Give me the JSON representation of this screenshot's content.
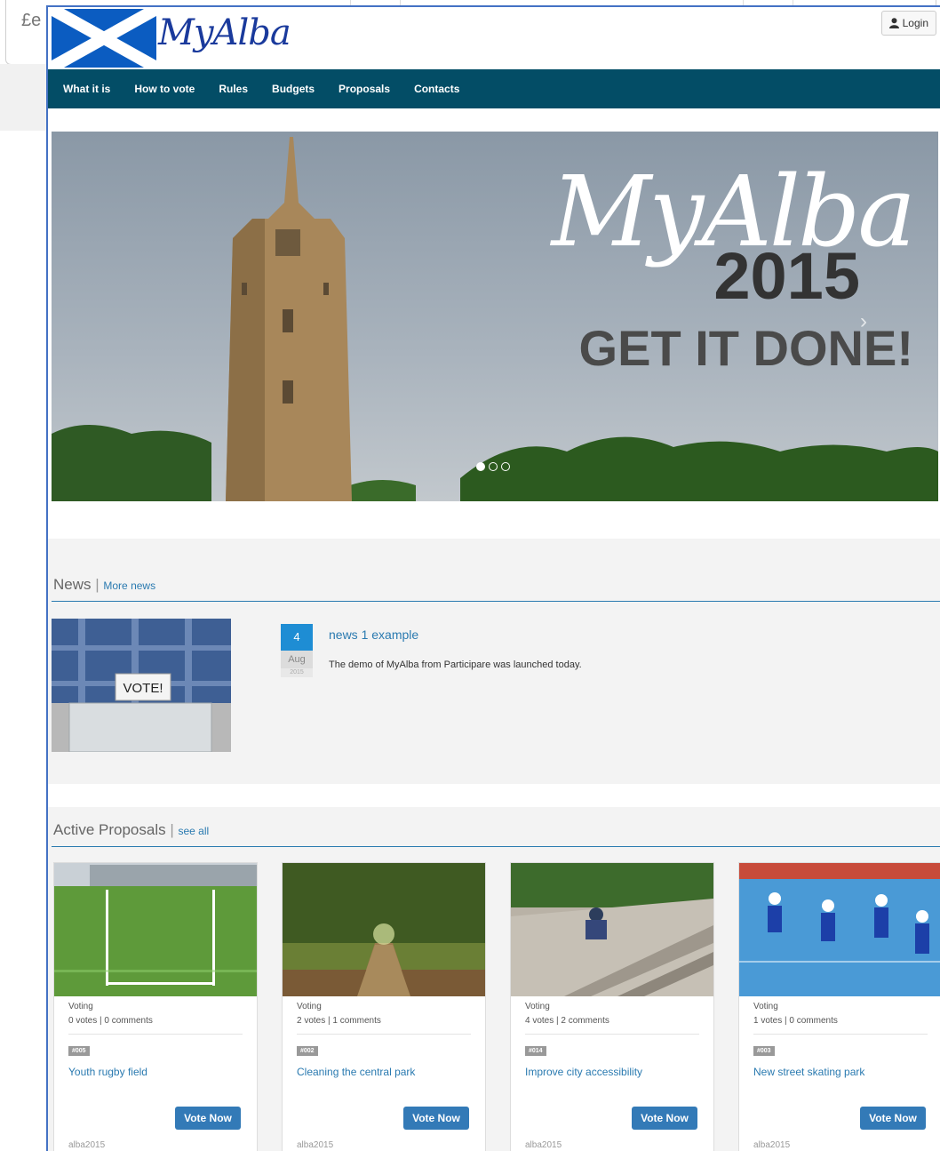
{
  "background": {
    "partial_text": "£e"
  },
  "header": {
    "logo_text": "MyAlba",
    "login_label": "Login"
  },
  "nav": {
    "items": [
      "What it is",
      "How to vote",
      "Rules",
      "Budgets",
      "Proposals",
      "Contacts"
    ]
  },
  "hero": {
    "title": "MyAlba",
    "year": "2015",
    "slogan": "GET IT DONE!",
    "slide_count": 3,
    "active_slide": 1
  },
  "news": {
    "heading": "News",
    "more_link": "More news",
    "items": [
      {
        "day": "4",
        "month": "Aug",
        "year": "2015",
        "title": "news 1 example",
        "body": "The demo of MyAlba from Participare was launched today.",
        "image_caption": "VOTE!"
      }
    ]
  },
  "proposals": {
    "heading": "Active Proposals",
    "see_all": "see all",
    "items": [
      {
        "status": "Voting",
        "stats": "0 votes | 0 comments",
        "tag": "#005",
        "title": "Youth rugby field",
        "button": "Vote Now",
        "author": "alba2015"
      },
      {
        "status": "Voting",
        "stats": "2 votes | 1 comments",
        "tag": "#002",
        "title": "Cleaning the central park",
        "button": "Vote Now",
        "author": "alba2015"
      },
      {
        "status": "Voting",
        "stats": "4 votes | 2 comments",
        "tag": "#014",
        "title": "Improve city accessibility",
        "button": "Vote Now",
        "author": "alba2015"
      },
      {
        "status": "Voting",
        "stats": "1 votes | 0 comments",
        "tag": "#003",
        "title": "New street skating park",
        "button": "Vote Now",
        "author": "alba2015"
      }
    ]
  },
  "colors": {
    "nav_bg": "#034d66",
    "link": "#2a7ab0",
    "button": "#337ab7",
    "frame": "#4472c4"
  }
}
